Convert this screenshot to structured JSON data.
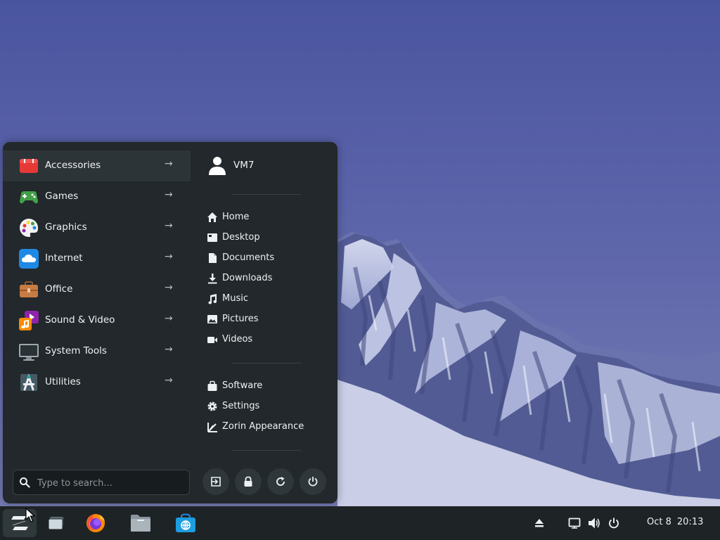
{
  "start_menu": {
    "categories": [
      {
        "label": "Accessories",
        "icon": "accessories-icon",
        "active": true
      },
      {
        "label": "Games",
        "icon": "games-icon"
      },
      {
        "label": "Graphics",
        "icon": "graphics-icon"
      },
      {
        "label": "Internet",
        "icon": "internet-icon"
      },
      {
        "label": "Office",
        "icon": "office-icon"
      },
      {
        "label": "Sound & Video",
        "icon": "sound-video-icon"
      },
      {
        "label": "System Tools",
        "icon": "system-tools-icon"
      },
      {
        "label": "Utilities",
        "icon": "utilities-icon"
      }
    ],
    "user": {
      "name": "VM7",
      "icon": "user-icon"
    },
    "places": [
      {
        "label": "Home",
        "icon": "home-icon"
      },
      {
        "label": "Desktop",
        "icon": "desktop-icon"
      },
      {
        "label": "Documents",
        "icon": "document-icon"
      },
      {
        "label": "Downloads",
        "icon": "download-icon"
      },
      {
        "label": "Music",
        "icon": "music-icon"
      },
      {
        "label": "Pictures",
        "icon": "pictures-icon"
      },
      {
        "label": "Videos",
        "icon": "video-icon"
      }
    ],
    "system": [
      {
        "label": "Software",
        "icon": "software-icon"
      },
      {
        "label": "Settings",
        "icon": "settings-icon"
      },
      {
        "label": "Zorin Appearance",
        "icon": "appearance-icon"
      }
    ],
    "search": {
      "placeholder": "Type to search..."
    },
    "power_buttons": [
      "logout-icon",
      "lock-icon",
      "restart-icon",
      "power-icon"
    ]
  },
  "taskbar": {
    "apps": [
      "zorin-menu-icon",
      "workspaces-icon",
      "firefox-icon",
      "files-icon",
      "software-store-icon"
    ],
    "tray": [
      "eject-icon",
      "display-icon",
      "volume-icon",
      "power-icon"
    ],
    "clock": {
      "date": "Oct 8",
      "time": "20:13"
    }
  },
  "colors": {
    "menu_bg": "#22282b",
    "taskbar_bg": "#1e2426",
    "sky": "#5f6aa8",
    "accent": "#21a0c4"
  }
}
